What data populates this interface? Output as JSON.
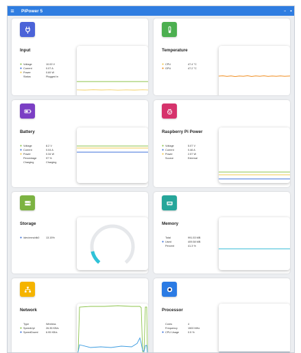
{
  "app": {
    "title": "PiPower 5"
  },
  "colors": {
    "titlebar": "#2f7de1",
    "series_green": "#8bc34a",
    "series_blue": "#3b6fd8",
    "series_yellow": "#f2c94c",
    "series_orange": "#f08c1e",
    "series_gray": "#8c99a8",
    "series_cyan": "#2fb9d6",
    "gauge_track": "#e6e8eb",
    "gauge_fill": "#2fc2d8"
  },
  "cards": {
    "input": {
      "title": "Input",
      "icon": "plug-icon",
      "icon_color": "#4b63d8",
      "rows": [
        {
          "label": "Voltage",
          "value": "10.00 V",
          "dot_color": "#8bc34a"
        },
        {
          "label": "Current",
          "value": "0.07 A",
          "dot_color": "#3b6fd8"
        },
        {
          "label": "Power",
          "value": "0.69 W",
          "dot_color": "#f2c94c"
        },
        {
          "label": "Status",
          "value": "Plugged in",
          "dot_color": ""
        }
      ]
    },
    "temperature": {
      "title": "Temperature",
      "icon": "thermometer-icon",
      "icon_color": "#4caf50",
      "rows": [
        {
          "label": "CPU",
          "value": "47.4 °C",
          "dot_color": "#f2c94c"
        },
        {
          "label": "GPU",
          "value": "47.2 °C",
          "dot_color": "#f08c1e"
        }
      ]
    },
    "battery": {
      "title": "Battery",
      "icon": "battery-icon",
      "icon_color": "#7b3fc4",
      "rows": [
        {
          "label": "Voltage",
          "value": "8.2 V",
          "dot_color": "#8bc34a"
        },
        {
          "label": "Current",
          "value": "0.04 A",
          "dot_color": "#3b6fd8"
        },
        {
          "label": "Power",
          "value": "0.34 W",
          "dot_color": "#f2c94c"
        },
        {
          "label": "Percentage",
          "value": "97 %",
          "dot_color": ""
        },
        {
          "label": "Charging",
          "value": "Charging",
          "dot_color": ""
        }
      ]
    },
    "rpi_power": {
      "title": "Raspberry Pi Power",
      "icon": "raspberry-icon",
      "icon_color": "#d6336c",
      "rows": [
        {
          "label": "Voltage",
          "value": "5.07 V",
          "dot_color": "#8bc34a"
        },
        {
          "label": "Current",
          "value": "0.46 A",
          "dot_color": "#3b6fd8"
        },
        {
          "label": "Power",
          "value": "2.57 W",
          "dot_color": "#f2c94c"
        },
        {
          "label": "Source",
          "value": "External",
          "dot_color": ""
        }
      ]
    },
    "storage": {
      "title": "Storage",
      "icon": "storage-icon",
      "icon_color": "#7cb342",
      "rows": [
        {
          "label": "/dev/mmcblk0",
          "value": "13.15%",
          "dot_color": "#3b6fd8"
        }
      ]
    },
    "memory": {
      "title": "Memory",
      "icon": "memory-icon",
      "icon_color": "#26a69a",
      "rows": [
        {
          "label": "Total",
          "value": "991.53 MB",
          "dot_color": ""
        },
        {
          "label": "Used",
          "value": "409.58 MB",
          "dot_color": "#3b6fd8"
        },
        {
          "label": "Percent",
          "value": "41.3 %",
          "dot_color": ""
        }
      ]
    },
    "network": {
      "title": "Network",
      "icon": "network-icon",
      "icon_color": "#f5b400",
      "rows": [
        {
          "label": "Type",
          "value": "Wireless",
          "dot_color": ""
        },
        {
          "label": "SpeedUpl",
          "value": "26.35 KB/s",
          "dot_color": "#8bc34a"
        },
        {
          "label": "SpeedDownl",
          "value": "6.95 KB/s",
          "dot_color": "#3b6fd8"
        }
      ]
    },
    "processor": {
      "title": "Processor",
      "icon": "cpu-icon",
      "icon_color": "#2b7be4",
      "rows": [
        {
          "label": "Cores",
          "value": "4",
          "dot_color": ""
        },
        {
          "label": "Frequency",
          "value": "1500 MHz",
          "dot_color": ""
        },
        {
          "label": "CPU Usage",
          "value": "0.5 %",
          "dot_color": "#3b6fd8"
        }
      ]
    }
  },
  "storage_gauge": {
    "percent": 13.15
  }
}
